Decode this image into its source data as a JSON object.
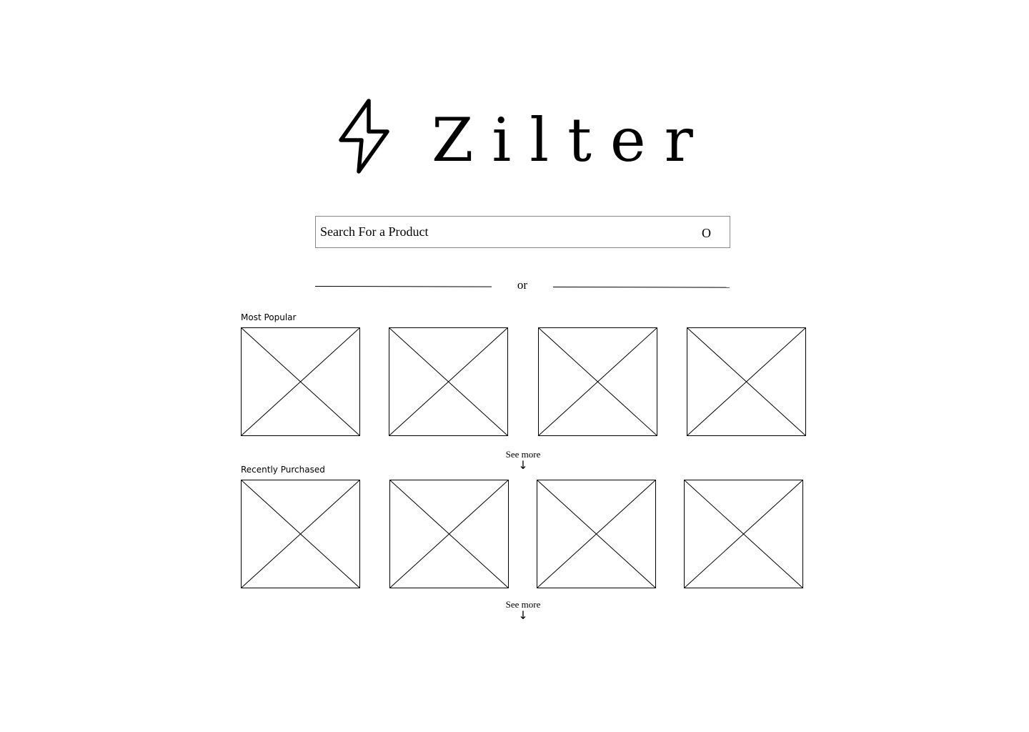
{
  "brand": {
    "name": "Zilter",
    "logo_icon": "lightning-bolt-icon"
  },
  "search": {
    "placeholder": "Search For a Product",
    "value": "",
    "button_glyph": "O"
  },
  "divider": {
    "label": "or"
  },
  "sections": [
    {
      "title": "Most Popular",
      "tile_count": 4,
      "see_more_label": "See more",
      "see_more_arrow": "↓"
    },
    {
      "title": "Recently Purchased",
      "tile_count": 4,
      "see_more_label": "See more",
      "see_more_arrow": "↓"
    }
  ]
}
